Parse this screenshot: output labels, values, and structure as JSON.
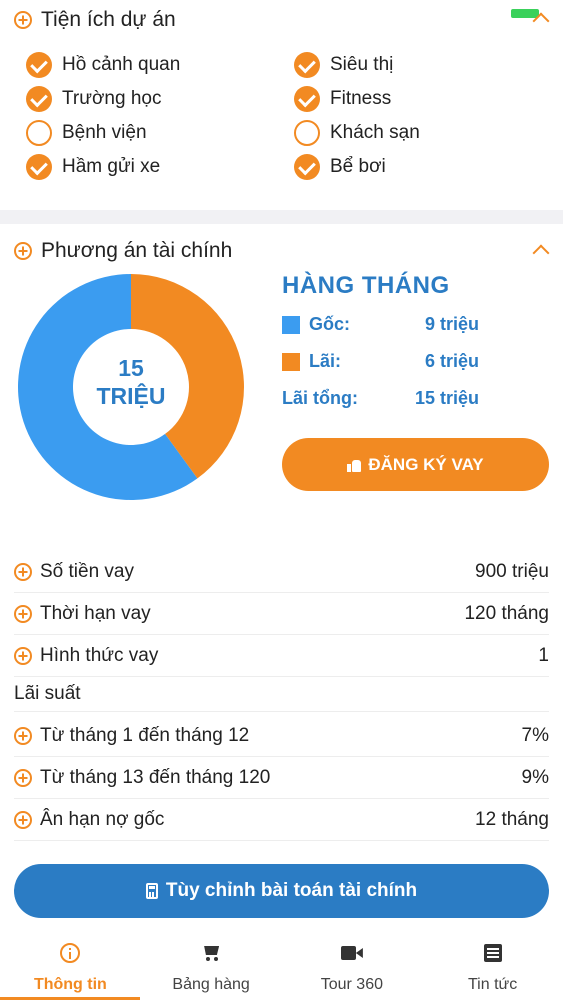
{
  "amenities": {
    "title": "Tiện ích dự án",
    "items": [
      {
        "label": "Hồ cảnh quan",
        "checked": true
      },
      {
        "label": "Siêu thị",
        "checked": true
      },
      {
        "label": "Trường học",
        "checked": true
      },
      {
        "label": "Fitness",
        "checked": true
      },
      {
        "label": "Bệnh viện",
        "checked": false
      },
      {
        "label": "Khách sạn",
        "checked": false
      },
      {
        "label": "Hầm gửi xe",
        "checked": true
      },
      {
        "label": "Bể bơi",
        "checked": true
      }
    ]
  },
  "finance": {
    "title": "Phương án tài chính",
    "donut_center_line1": "15",
    "donut_center_line2": "TRIỆU",
    "monthly_title": "HÀNG THÁNG",
    "principal_label": "Gốc:",
    "principal_value": "9 triệu",
    "interest_label": "Lãi:",
    "interest_value": "6 triệu",
    "total_label": "Lãi tổng:",
    "total_value": "15 triệu",
    "register_button": "ĐĂNG KÝ VAY",
    "rows": {
      "loan_amount_label": "Số tiền vay",
      "loan_amount_value": "900 triệu",
      "loan_term_label": "Thời hạn vay",
      "loan_term_value": "120 tháng",
      "loan_type_label": "Hình thức vay",
      "loan_type_value": "1",
      "interest_rate_heading": "Lãi suất",
      "rate1_label": "Từ tháng 1 đến tháng 12",
      "rate1_value": "7%",
      "rate2_label": "Từ tháng 13 đến tháng 120",
      "rate2_value": "9%",
      "grace_label": "Ân hạn nợ gốc",
      "grace_value": "12 tháng"
    },
    "customize_button": "Tùy chỉnh bài toán tài chính"
  },
  "chart_data": {
    "type": "pie",
    "categories": [
      "Gốc",
      "Lãi"
    ],
    "values": [
      9,
      6
    ],
    "colors": [
      "#3b9cf0",
      "#f28a22"
    ]
  },
  "colors": {
    "accent": "#f28a22",
    "primary_blue": "#2b7cc4",
    "chart_blue": "#3b9cf0"
  },
  "bottom_nav": {
    "tabs": [
      {
        "label": "Thông tin",
        "icon": "info-icon",
        "active": true
      },
      {
        "label": "Bảng hàng",
        "icon": "cart-icon",
        "active": false
      },
      {
        "label": "Tour 360",
        "icon": "video-icon",
        "active": false
      },
      {
        "label": "Tin tức",
        "icon": "list-icon",
        "active": false
      }
    ]
  }
}
